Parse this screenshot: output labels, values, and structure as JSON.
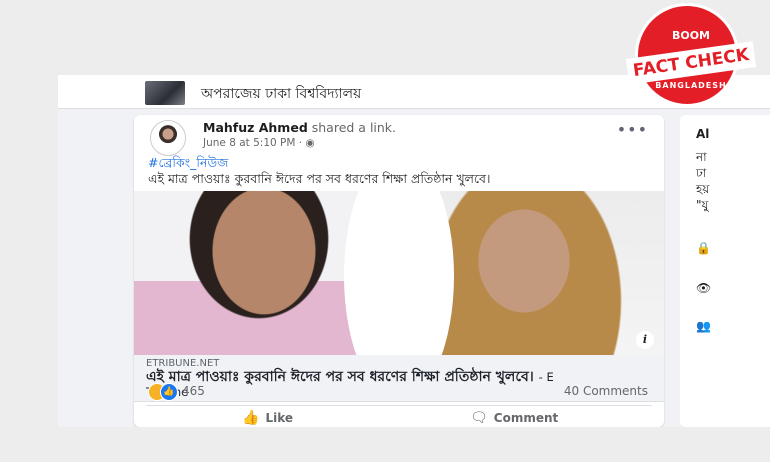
{
  "group": {
    "title": "অপরাজেয় ঢাকা বিশ্ববিদ্যালয়"
  },
  "post": {
    "author": "Mahfuz Ahmed",
    "action_text": "shared a link.",
    "timestamp": "June 8 at 5:10 PM",
    "dot": "·",
    "privacy_icon": "globe-icon",
    "more_label": "•••",
    "hashtag": "#ব্রেকিং_নিউজ",
    "text": "এই মাত্র পাওয়াঃ কুরবানি ঈদের পর সব ধরণের শিক্ষা প্রতিষ্ঠান খুলবে।"
  },
  "link": {
    "domain": "ETRIBUNE.NET",
    "title": "এই মাত্র পাওয়াঃ কুরবানি ঈদের পর সব ধরণের শিক্ষা প্রতিষ্ঠান খুলবে।",
    "source": "- E Tribune",
    "info_label": "i"
  },
  "stats": {
    "reaction_count": "465",
    "comments": "40 Comments"
  },
  "actions": {
    "like": "Like",
    "comment": "Comment"
  },
  "side_panel": {
    "lines": [
      "Al",
      "না",
      "ঢা",
      "হয়",
      "\"যু"
    ]
  },
  "badge": {
    "brand": "BOOM",
    "label": "FACT CHECK",
    "country": "BANGLADESH",
    "color": "#e41e26"
  }
}
